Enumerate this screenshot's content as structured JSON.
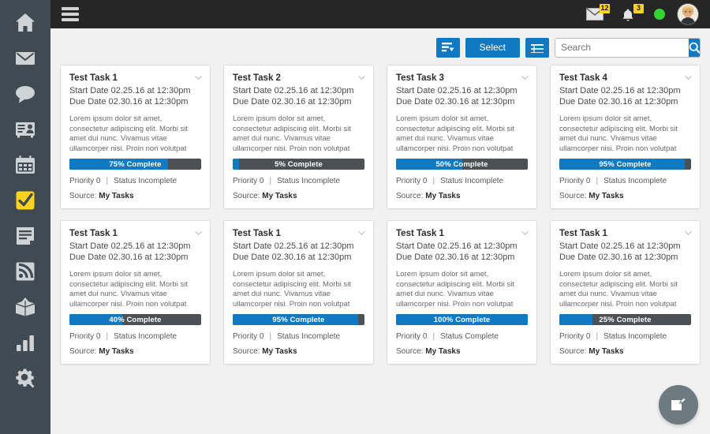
{
  "sidebar": {
    "items": [
      {
        "icon": "home-icon",
        "label": "Home",
        "active": false
      },
      {
        "icon": "mail-icon",
        "label": "Mail",
        "active": false
      },
      {
        "icon": "chat-icon",
        "label": "Chat",
        "active": false
      },
      {
        "icon": "contacts-icon",
        "label": "Contacts",
        "active": false
      },
      {
        "icon": "calendar-icon",
        "label": "Calendar",
        "active": false
      },
      {
        "icon": "check-icon",
        "label": "Tasks",
        "active": true
      },
      {
        "icon": "document-icon",
        "label": "Notes",
        "active": false
      },
      {
        "icon": "rss-icon",
        "label": "Feeds",
        "active": false
      },
      {
        "icon": "box-icon",
        "label": "Archive",
        "active": false
      },
      {
        "icon": "chart-icon",
        "label": "Reports",
        "active": false
      },
      {
        "icon": "gear-icon",
        "label": "Settings",
        "active": false
      }
    ],
    "accent_active": "#ffd21f",
    "background": "#3f4a52"
  },
  "topbar": {
    "menu_icon": "hamburger-icon",
    "background": "#262626",
    "mail": {
      "icon": "mail-icon",
      "badge": "12"
    },
    "notifications": {
      "icon": "bell-icon",
      "badge": "3"
    },
    "status": {
      "icon": "status-dot",
      "color": "#35d435"
    },
    "avatar": {
      "icon": "avatar",
      "label": "User profile"
    }
  },
  "toolbar": {
    "sort_icon": "sort-filter-icon",
    "select_label": "Select",
    "list_view_icon": "list-view-icon",
    "search": {
      "placeholder": "Search",
      "value": "",
      "icon": "search-icon"
    },
    "accent": "#1179c1"
  },
  "cards": [
    {
      "title": "Test Task 1",
      "start_date": "Start Date 02.25.16 at 12:30pm",
      "due_date": "Due Date 02.30.16 at 12:30pm",
      "description": "Lorem ipsum dolor sit amet, consectetur adipiscing elit. Morbi sit amet dui nunc. Vivamus vitae ullamcorper nisi. Proin non volutpat felis, a efficitur libero. Cras ac pretium neque. Fusce porta massa ut efficitur male-",
      "progress": 75,
      "progress_label": "75% Complete",
      "priority": "Priority 0",
      "status": "Status Incomplete",
      "source_label": "Source:",
      "source_value": "My Tasks",
      "chevron_icon": "chevron-down-icon"
    },
    {
      "title": "Test Task 2",
      "start_date": "Start Date 02.25.16 at 12:30pm",
      "due_date": "Due Date 02.30.16 at 12:30pm",
      "description": "Lorem ipsum dolor sit amet, consectetur adipiscing elit. Morbi sit amet dui nunc. Vivamus vitae ullamcorper nisi. Proin non volutpat felis, a efficitur libero. Cras ac pretium neque. Fusce porta massa ut efficitur male-",
      "progress": 5,
      "progress_label": "5% Complete",
      "priority": "Priority 0",
      "status": "Status Incomplete",
      "source_label": "Source:",
      "source_value": "My Tasks",
      "chevron_icon": "chevron-down-icon"
    },
    {
      "title": "Test Task 3",
      "start_date": "Start Date 02.25.16 at 12:30pm",
      "due_date": "Due Date 02.30.16 at 12:30pm",
      "description": "Lorem ipsum dolor sit amet, consectetur adipiscing elit. Morbi sit amet dui nunc. Vivamus vitae ullamcorper nisi. Proin non volutpat felis, a efficitur libero. Cras ac pretium neque. Fusce porta massa ut efficitur male-",
      "progress": 50,
      "progress_label": "50% Complete",
      "priority": "Priority 0",
      "status": "Status Incomplete",
      "source_label": "Source:",
      "source_value": "My Tasks",
      "chevron_icon": "chevron-down-icon"
    },
    {
      "title": "Test Task 4",
      "start_date": "Start Date 02.25.16 at 12:30pm",
      "due_date": "Due Date 02.30.16 at 12:30pm",
      "description": "Lorem ipsum dolor sit amet, consectetur adipiscing elit. Morbi sit amet dui nunc. Vivamus vitae ullamcorper nisi. Proin non volutpat felis, a efficitur libero. Cras ac pretium neque. Fusce porta massa ut efficitur male-",
      "progress": 95,
      "progress_label": "95% Complete",
      "priority": "Priority 0",
      "status": "Status Incomplete",
      "source_label": "Source:",
      "source_value": "My Tasks",
      "chevron_icon": "chevron-down-icon"
    },
    {
      "title": "Test Task 1",
      "start_date": "Start Date 02.25.16 at 12:30pm",
      "due_date": "Due Date 02.30.16 at 12:30pm",
      "description": "Lorem ipsum dolor sit amet, consectetur adipiscing elit. Morbi sit amet dui nunc. Vivamus vitae ullamcorper nisi. Proin non volutpat felis, a efficitur libero. Cras ac pretium neque. Fusce porta massa ut efficitur male-",
      "progress": 40,
      "progress_label": "40% Complete",
      "priority": "Priority 0",
      "status": "Status Incomplete",
      "source_label": "Source:",
      "source_value": "My Tasks",
      "chevron_icon": "chevron-down-icon"
    },
    {
      "title": "Test Task 1",
      "start_date": "Start Date 02.25.16 at 12:30pm",
      "due_date": "Due Date 02.30.16 at 12:30pm",
      "description": "Lorem ipsum dolor sit amet, consectetur adipiscing elit. Morbi sit amet dui nunc. Vivamus vitae ullamcorper nisi. Proin non volutpat felis, a efficitur libero. Cras ac pretium neque. Fusce porta massa ut efficitur male-",
      "progress": 95,
      "progress_label": "95% Complete",
      "priority": "Priority 0",
      "status": "Status Incomplete",
      "source_label": "Source:",
      "source_value": "My Tasks",
      "chevron_icon": "chevron-down-icon"
    },
    {
      "title": "Test Task 1",
      "start_date": "Start Date 02.25.16 at 12:30pm",
      "due_date": "Due Date 02.30.16 at 12:30pm",
      "description": "Lorem ipsum dolor sit amet, consectetur adipiscing elit. Morbi sit amet dui nunc. Vivamus vitae ullamcorper nisi. Proin non volutpat felis, a efficitur libero. Cras ac pretium neque. Fusce porta massa ut efficitur male-",
      "progress": 100,
      "progress_label": "100% Complete",
      "priority": "Priority 0",
      "status": "Status Complete",
      "source_label": "Source:",
      "source_value": "My Tasks",
      "chevron_icon": "chevron-down-icon"
    },
    {
      "title": "Test Task 1",
      "start_date": "Start Date 02.25.16 at 12:30pm",
      "due_date": "Due Date 02.30.16 at 12:30pm",
      "description": "Lorem ipsum dolor sit amet, consectetur adipiscing elit. Morbi sit amet dui nunc. Vivamus vitae ullamcorper nisi. Proin non volutpat felis, a efficitur libero. Cras ac pretium neque. Fusce porta massa ut efficitur male-",
      "progress": 25,
      "progress_label": "25% Complete",
      "priority": "Priority 0",
      "status": "Status Incomplete",
      "source_label": "Source:",
      "source_value": "My Tasks",
      "chevron_icon": "chevron-down-icon"
    }
  ],
  "fab": {
    "icon": "compose-note-icon",
    "label": "New task"
  }
}
